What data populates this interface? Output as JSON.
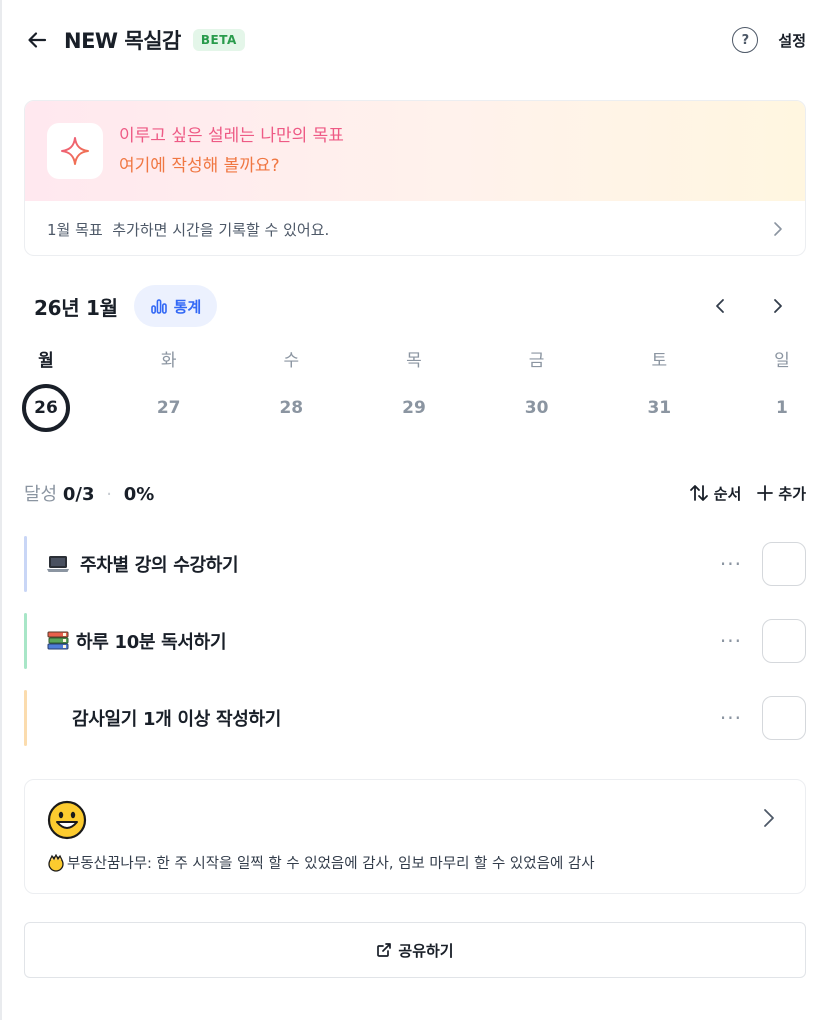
{
  "header": {
    "title": "NEW 목실감",
    "badge": "BETA",
    "settings_label": "설정",
    "help_label": "?"
  },
  "goal_card": {
    "line1": "이루고 싶은 설레는 나만의 목표",
    "line2": "여기에 작성해 볼까요?",
    "footer": "1월 목표  추가하면 시간을 기록할 수 있어요."
  },
  "calendar": {
    "month_label": "26년 1월",
    "stats_label": "통계",
    "weekdays": [
      "월",
      "화",
      "수",
      "목",
      "금",
      "토",
      "일"
    ],
    "dates": [
      "26",
      "27",
      "28",
      "29",
      "30",
      "31",
      "1"
    ],
    "selected_index": 0
  },
  "achievement": {
    "label": "달성",
    "count": "0/3",
    "separator": "·",
    "percent": "0%",
    "order_label": "순서",
    "add_label": "추가"
  },
  "todos": [
    {
      "icon": "laptop-icon",
      "text": "주차별 강의 수강하기",
      "bar_color": "#c9d6f6",
      "checked": false
    },
    {
      "icon": "books-icon",
      "text": "하루 10분 독서하기",
      "bar_color": "#a8e6c7",
      "checked": false
    },
    {
      "icon": "",
      "text": "감사일기 1개 이상 작성하기",
      "bar_color": "#fbdcae",
      "checked": false
    }
  ],
  "todo_more_label": "···",
  "diary": {
    "emoji": "smiling-face-icon",
    "text": "부동산꿈나무: 한 주 시작을 일찍 할 수 있었음에 감사, 임보 마무리 할 수 있었음에 감사"
  },
  "share": {
    "label": "공유하기"
  },
  "colors": {
    "accent_blue": "#3268f5",
    "pink": "#ee5a85",
    "orange": "#f07742",
    "beta_green": "#2a9b4c"
  }
}
